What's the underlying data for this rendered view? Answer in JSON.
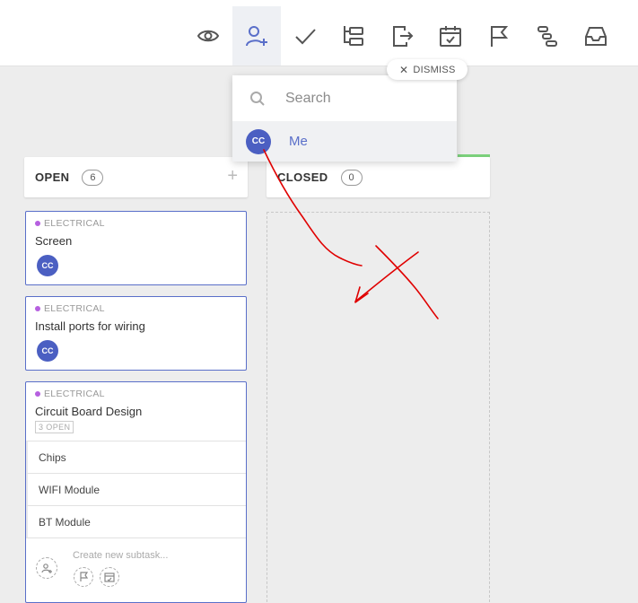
{
  "toolbar": {
    "icons": [
      "eye-icon",
      "assign-user-icon",
      "checkmark-icon",
      "subtasks-icon",
      "move-icon",
      "calendar-icon",
      "flag-icon",
      "gantt-icon",
      "inbox-icon"
    ]
  },
  "dismiss": {
    "label": "DISMISS"
  },
  "assignee_dropdown": {
    "search_placeholder": "Search",
    "options": [
      {
        "initials": "CC",
        "label": "Me"
      }
    ]
  },
  "columns": [
    {
      "title": "OPEN",
      "count": "6",
      "add": "+"
    },
    {
      "title": "CLOSED",
      "count": "0"
    }
  ],
  "cards": [
    {
      "tag": "ELECTRICAL",
      "title": "Screen",
      "assignee": "CC"
    },
    {
      "tag": "ELECTRICAL",
      "title": "Install ports for wiring",
      "assignee": "CC"
    },
    {
      "tag": "ELECTRICAL",
      "title": "Circuit Board Design",
      "subtask_count": "3 OPEN",
      "subtasks": [
        "Chips",
        "WIFI Module",
        "BT Module"
      ],
      "new_subtask_placeholder": "Create new subtask..."
    }
  ],
  "colors": {
    "accent": "#5a6fc9",
    "avatar": "#4b5fc2",
    "tag_dot": "#b660e0",
    "closed_bar": "#7bd07b",
    "annotation": "#e00000"
  }
}
